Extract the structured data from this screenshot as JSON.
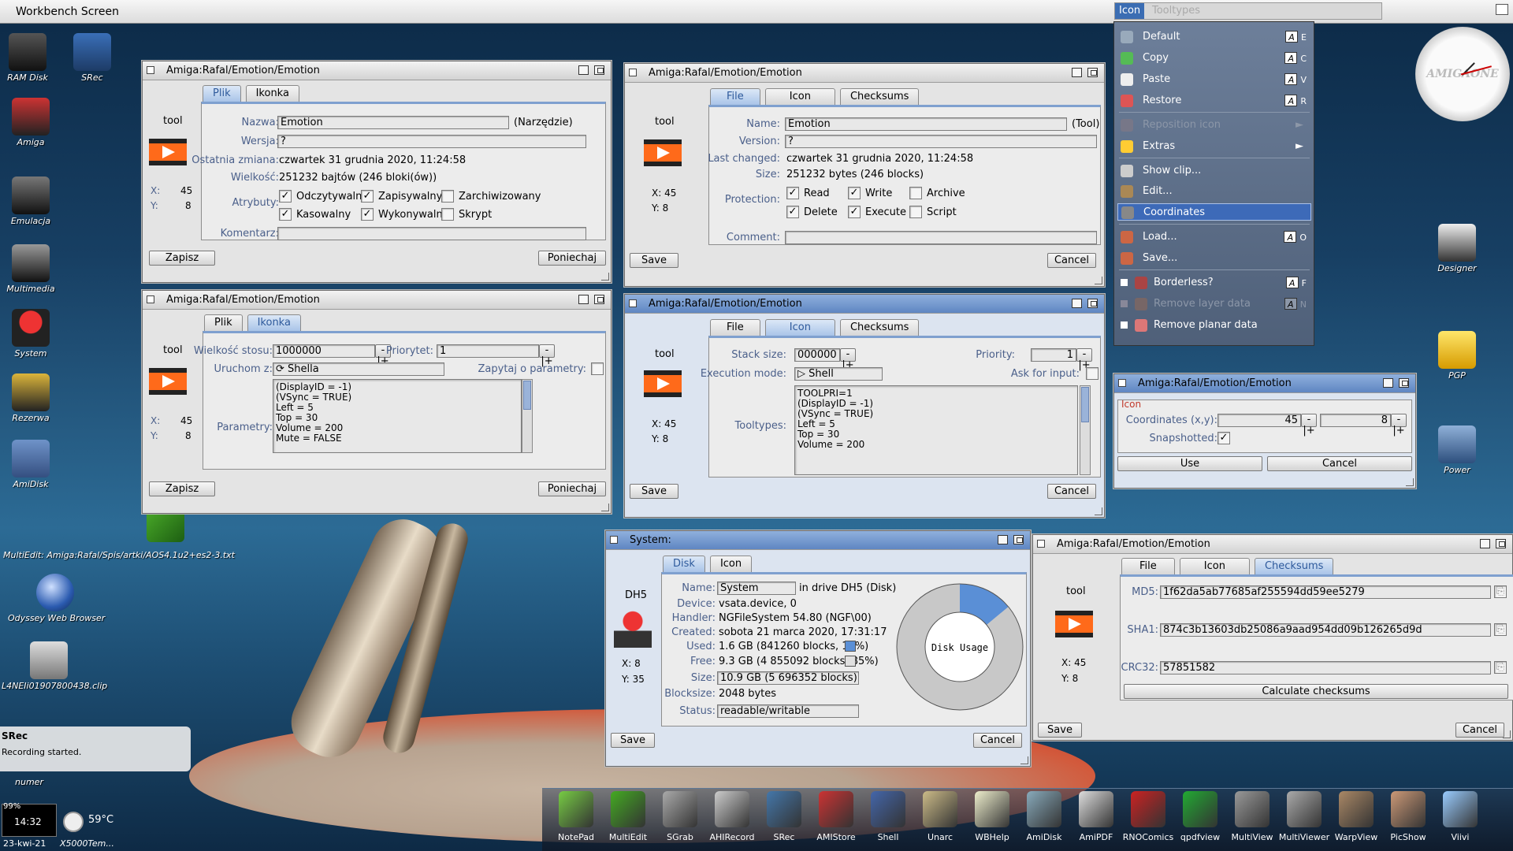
{
  "screen": {
    "title": "Workbench Screen"
  },
  "desktop": {
    "icons": [
      {
        "label": "RAM Disk"
      },
      {
        "label": "SRec"
      },
      {
        "label": "Amiga"
      },
      {
        "label": "Emulacja"
      },
      {
        "label": "Multimedia"
      },
      {
        "label": "System"
      },
      {
        "label": "Rezerwa"
      },
      {
        "label": "AmiDisk"
      },
      {
        "label": "MultiEdit: Amiga:Rafal/Spis/artki/AOS4.1u2+es2-3.txt"
      },
      {
        "label": "Odyssey Web Browser"
      },
      {
        "label": "L4NEIi01907800438.clip"
      },
      {
        "label": "numer"
      },
      {
        "label": "Designer"
      },
      {
        "label": "PGP"
      },
      {
        "label": "Power"
      }
    ]
  },
  "menu": {
    "strip": {
      "icon": "Icon",
      "tooltypes": "Tooltypes"
    },
    "items": [
      {
        "label": "Default",
        "key": "E"
      },
      {
        "label": "Copy",
        "key": "C"
      },
      {
        "label": "Paste",
        "key": "V"
      },
      {
        "label": "Restore",
        "key": "R"
      },
      {
        "label": "Reposition icon"
      },
      {
        "label": "Extras"
      },
      {
        "label": "Show clip..."
      },
      {
        "label": "Edit..."
      },
      {
        "label": "Coordinates"
      },
      {
        "label": "Load...",
        "key": "O"
      },
      {
        "label": "Save..."
      },
      {
        "label": "Borderless?",
        "key": "F"
      },
      {
        "label": "Remove layer data",
        "key": "N"
      },
      {
        "label": "Remove planar data"
      }
    ],
    "arrow": "►"
  },
  "clock": {
    "brand": "AMIGAONE"
  },
  "w1": {
    "title": "Amiga:Rafal/Emotion/Emotion",
    "tabs": [
      "Plik",
      "Ikonka"
    ],
    "tool": "tool",
    "x_label": "X:",
    "x": "45",
    "y_label": "Y:",
    "y": "8",
    "nazwa_l": "Nazwa:",
    "nazwa": "Emotion",
    "nazwa_type": "(Narzędzie)",
    "wersja_l": "Wersja:",
    "wersja": "?",
    "zmiana_l": "Ostatnia zmiana:",
    "zmiana": "czwartek 31 grudnia 2020, 11:24:58",
    "wielkosc_l": "Wielkość:",
    "wielkosc": "251232 bajtów (246 bloki(ów))",
    "atrybuty_l": "Atrybuty:",
    "a1": "Odczytywalny",
    "a2": "Zapisywalny",
    "a3": "Zarchiwizowany",
    "a4": "Kasowalny",
    "a5": "Wykonywalny",
    "a6": "Skrypt",
    "komentarz_l": "Komentarz:",
    "save": "Zapisz",
    "cancel": "Poniechaj"
  },
  "w2": {
    "title": "Amiga:Rafal/Emotion/Emotion",
    "tabs": [
      "File",
      "Icon",
      "Checksums"
    ],
    "tool": "tool",
    "x": "X: 45",
    "y": "Y: 8",
    "name_l": "Name:",
    "name": "Emotion",
    "name_type": "(Tool)",
    "version_l": "Version:",
    "version": "?",
    "changed_l": "Last changed:",
    "changed": "czwartek 31 grudnia 2020, 11:24:58",
    "size_l": "Size:",
    "size": "251232 bytes (246 blocks)",
    "prot_l": "Protection:",
    "p1": "Read",
    "p2": "Write",
    "p3": "Archive",
    "p4": "Delete",
    "p5": "Execute",
    "p6": "Script",
    "comment_l": "Comment:",
    "save": "Save",
    "cancel": "Cancel"
  },
  "w3": {
    "title": "Amiga:Rafal/Emotion/Emotion",
    "tabs": [
      "Plik",
      "Ikonka"
    ],
    "tool": "tool",
    "x_label": "X:",
    "x": "45",
    "y_label": "Y:",
    "y": "8",
    "stack_l": "Wielkość stosu:",
    "stack": "1000000",
    "prio_l": "Priorytet:",
    "prio": "1",
    "run_l": "Uruchom z:",
    "run": "Shella",
    "ask_l": "Zapytaj o parametry:",
    "params_l": "Parametry:",
    "params": "(DisplayID = -1)\n(VSync = TRUE)\nLeft = 5\nTop = 30\nVolume = 200\nMute = FALSE",
    "save": "Zapisz",
    "cancel": "Poniechaj"
  },
  "w4": {
    "title": "Amiga:Rafal/Emotion/Emotion",
    "tabs": [
      "File",
      "Icon",
      "Checksums"
    ],
    "tool": "tool",
    "x": "X: 45",
    "y": "Y: 8",
    "stack_l": "Stack size:",
    "stack": "000000",
    "prio_l": "Priority:",
    "prio": "1",
    "exec_l": "Execution mode:",
    "exec": "Shell",
    "ask_l": "Ask for input:",
    "tt_l": "Tooltypes:",
    "tt": "TOOLPRI=1\n(DisplayID = -1)\n(VSync = TRUE)\nLeft = 5\nTop = 30\nVolume = 200",
    "save": "Save",
    "cancel": "Cancel"
  },
  "w5": {
    "title": "Amiga:Rafal/Emotion/Emotion",
    "group": "Icon",
    "coords_l": "Coordinates (x,y):",
    "cx": "45",
    "cy": "8",
    "snap_l": "Snapshotted:",
    "use": "Use",
    "cancel": "Cancel"
  },
  "w6": {
    "title": "System:",
    "tabs": [
      "Disk",
      "Icon"
    ],
    "dev": "DH5",
    "x": "X: 8",
    "y": "Y: 35",
    "name_l": "Name:",
    "name": "System",
    "name_suffix": "in drive DH5 (Disk)",
    "device_l": "Device:",
    "device": "vsata.device, 0",
    "handler_l": "Handler:",
    "handler": "NGFileSystem 54.80 (NGF\\00)",
    "created_l": "Created:",
    "created": "sobota 21 marca 2020, 17:31:17",
    "used_l": "Used:",
    "used": "1.6 GB (841260 blocks, 14%)",
    "free_l": "Free:",
    "free": "9.3 GB (4 855092 blocks, 85%)",
    "size_l": "Size:",
    "size": "10.9 GB (5 696352 blocks)",
    "bs_l": "Blocksize:",
    "bs": "2048 bytes",
    "status_l": "Status:",
    "status": "readable/writable",
    "chart_label": "Disk Usage",
    "used_pct": 14,
    "save": "Save",
    "cancel": "Cancel"
  },
  "w7": {
    "title": "Amiga:Rafal/Emotion/Emotion",
    "tabs": [
      "File",
      "Icon",
      "Checksums"
    ],
    "tool": "tool",
    "x": "X: 45",
    "y": "Y: 8",
    "md5_l": "MD5:",
    "md5": "1f62da5ab77685af255594dd59ee5279",
    "sha1_l": "SHA1:",
    "sha1": "874c3b13603db25086a9aad954dd09b126265d9d",
    "crc_l": "CRC32:",
    "crc": "57851582",
    "calc": "Calculate checksums",
    "save": "Save",
    "cancel": "Cancel"
  },
  "notify": {
    "title": "SRec",
    "text": "Recording started."
  },
  "monitor": {
    "cpu": "99%",
    "time": "14:32",
    "date": "23-kwi-21",
    "temp": "59°C",
    "name": "X5000Tem..."
  },
  "dock": [
    "NotePad",
    "MultiEdit",
    "SGrab",
    "AHIRecord",
    "SRec",
    "AMIStore",
    "Shell",
    "Unarc",
    "WBHelp",
    "AmiDisk",
    "AmiPDF",
    "RNOComics",
    "qpdfview",
    "MultiView",
    "MultiViewer",
    "WarpView",
    "PicShow",
    "Viivi"
  ],
  "colors": {
    "accent": "#5f86c2",
    "label": "#4a5f8a",
    "movie": "#ff6a1a"
  }
}
